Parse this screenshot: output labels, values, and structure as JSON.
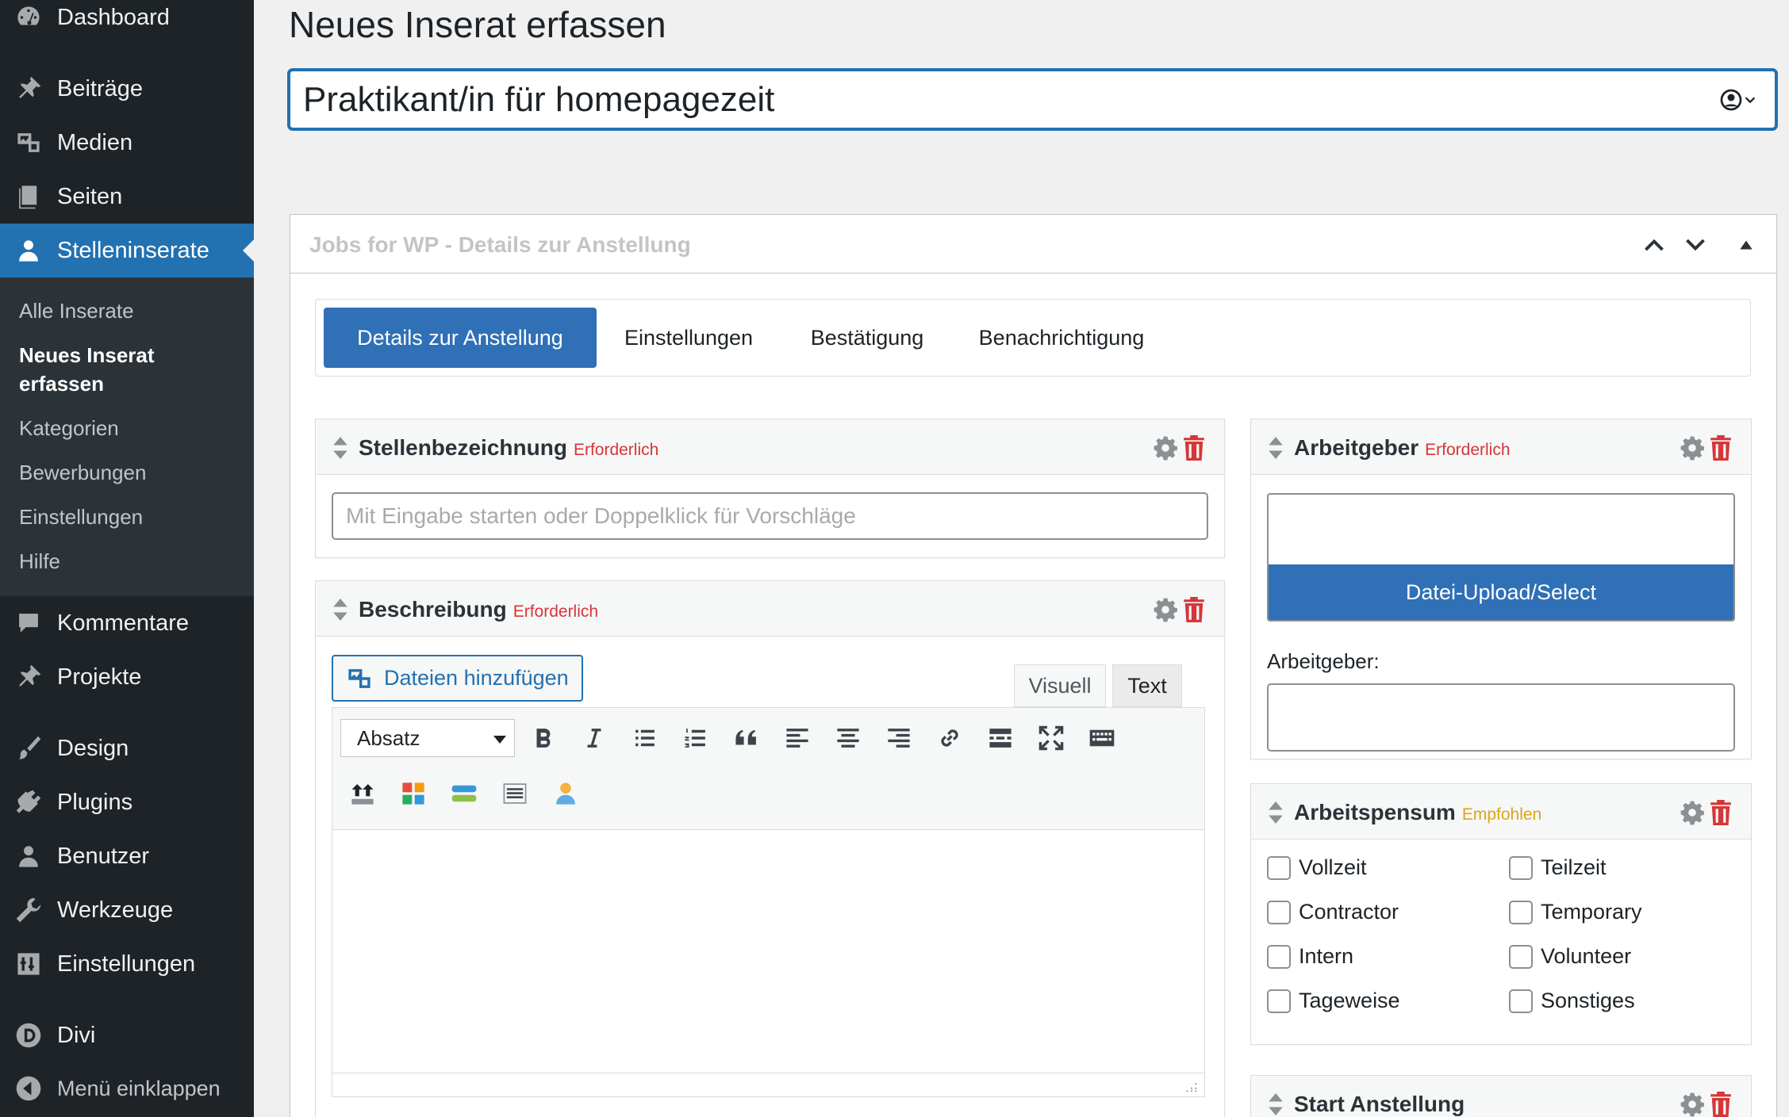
{
  "sidebar": {
    "items": [
      {
        "label": "Dashboard",
        "icon": "dashboard-icon"
      },
      {
        "label": "Beiträge",
        "icon": "pin-icon"
      },
      {
        "label": "Medien",
        "icon": "media-icon"
      },
      {
        "label": "Seiten",
        "icon": "pages-icon"
      },
      {
        "label": "Stelleninserate",
        "icon": "user-icon"
      },
      {
        "label": "Kommentare",
        "icon": "comment-icon"
      },
      {
        "label": "Projekte",
        "icon": "pin-icon"
      },
      {
        "label": "Design",
        "icon": "brush-icon"
      },
      {
        "label": "Plugins",
        "icon": "plugin-icon"
      },
      {
        "label": "Benutzer",
        "icon": "users-icon"
      },
      {
        "label": "Werkzeuge",
        "icon": "wrench-icon"
      },
      {
        "label": "Einstellungen",
        "icon": "settings-icon"
      },
      {
        "label": "Divi",
        "icon": "divi-icon"
      },
      {
        "label": "Menü einklappen",
        "icon": "collapse-icon"
      }
    ],
    "submenu": [
      {
        "label": "Alle Inserate"
      },
      {
        "label": "Neues Inserat erfassen"
      },
      {
        "label": "Kategorien"
      },
      {
        "label": "Bewerbungen"
      },
      {
        "label": "Einstellungen"
      },
      {
        "label": "Hilfe"
      }
    ]
  },
  "page": {
    "title": "Neues Inserat erfassen",
    "post_title_value": "Praktikant/in für homepagezeit"
  },
  "postbox": {
    "title": "Jobs for WP - Details zur Anstellung",
    "tabs": [
      {
        "label": "Details zur Anstellung"
      },
      {
        "label": "Einstellungen"
      },
      {
        "label": "Bestätigung"
      },
      {
        "label": "Benachrichtigung"
      }
    ]
  },
  "fields": {
    "stellenbezeichnung": {
      "title": "Stellenbezeichnung",
      "badge": "Erforderlich",
      "placeholder": "Mit Eingabe starten oder Doppelklick für Vorschläge"
    },
    "beschreibung": {
      "title": "Beschreibung",
      "badge": "Erforderlich",
      "add_media": "Dateien hinzufügen",
      "tab_visual": "Visuell",
      "tab_text": "Text",
      "format": "Absatz"
    },
    "arbeitgeber": {
      "title": "Arbeitgeber",
      "badge": "Erforderlich",
      "upload_label": "Datei-Upload/Select",
      "employer_label": "Arbeitgeber:"
    },
    "arbeitspensum": {
      "title": "Arbeitspensum",
      "badge": "Empfohlen",
      "options": [
        "Vollzeit",
        "Teilzeit",
        "Contractor",
        "Temporary",
        "Intern",
        "Volunteer",
        "Tageweise",
        "Sonstiges"
      ]
    },
    "start": {
      "title": "Start Anstellung"
    }
  },
  "colors": {
    "sidebar_bg": "#1d2327",
    "accent": "#2271b1",
    "required": "#d63638",
    "recommended": "#dba617",
    "trash": "#d63638"
  }
}
